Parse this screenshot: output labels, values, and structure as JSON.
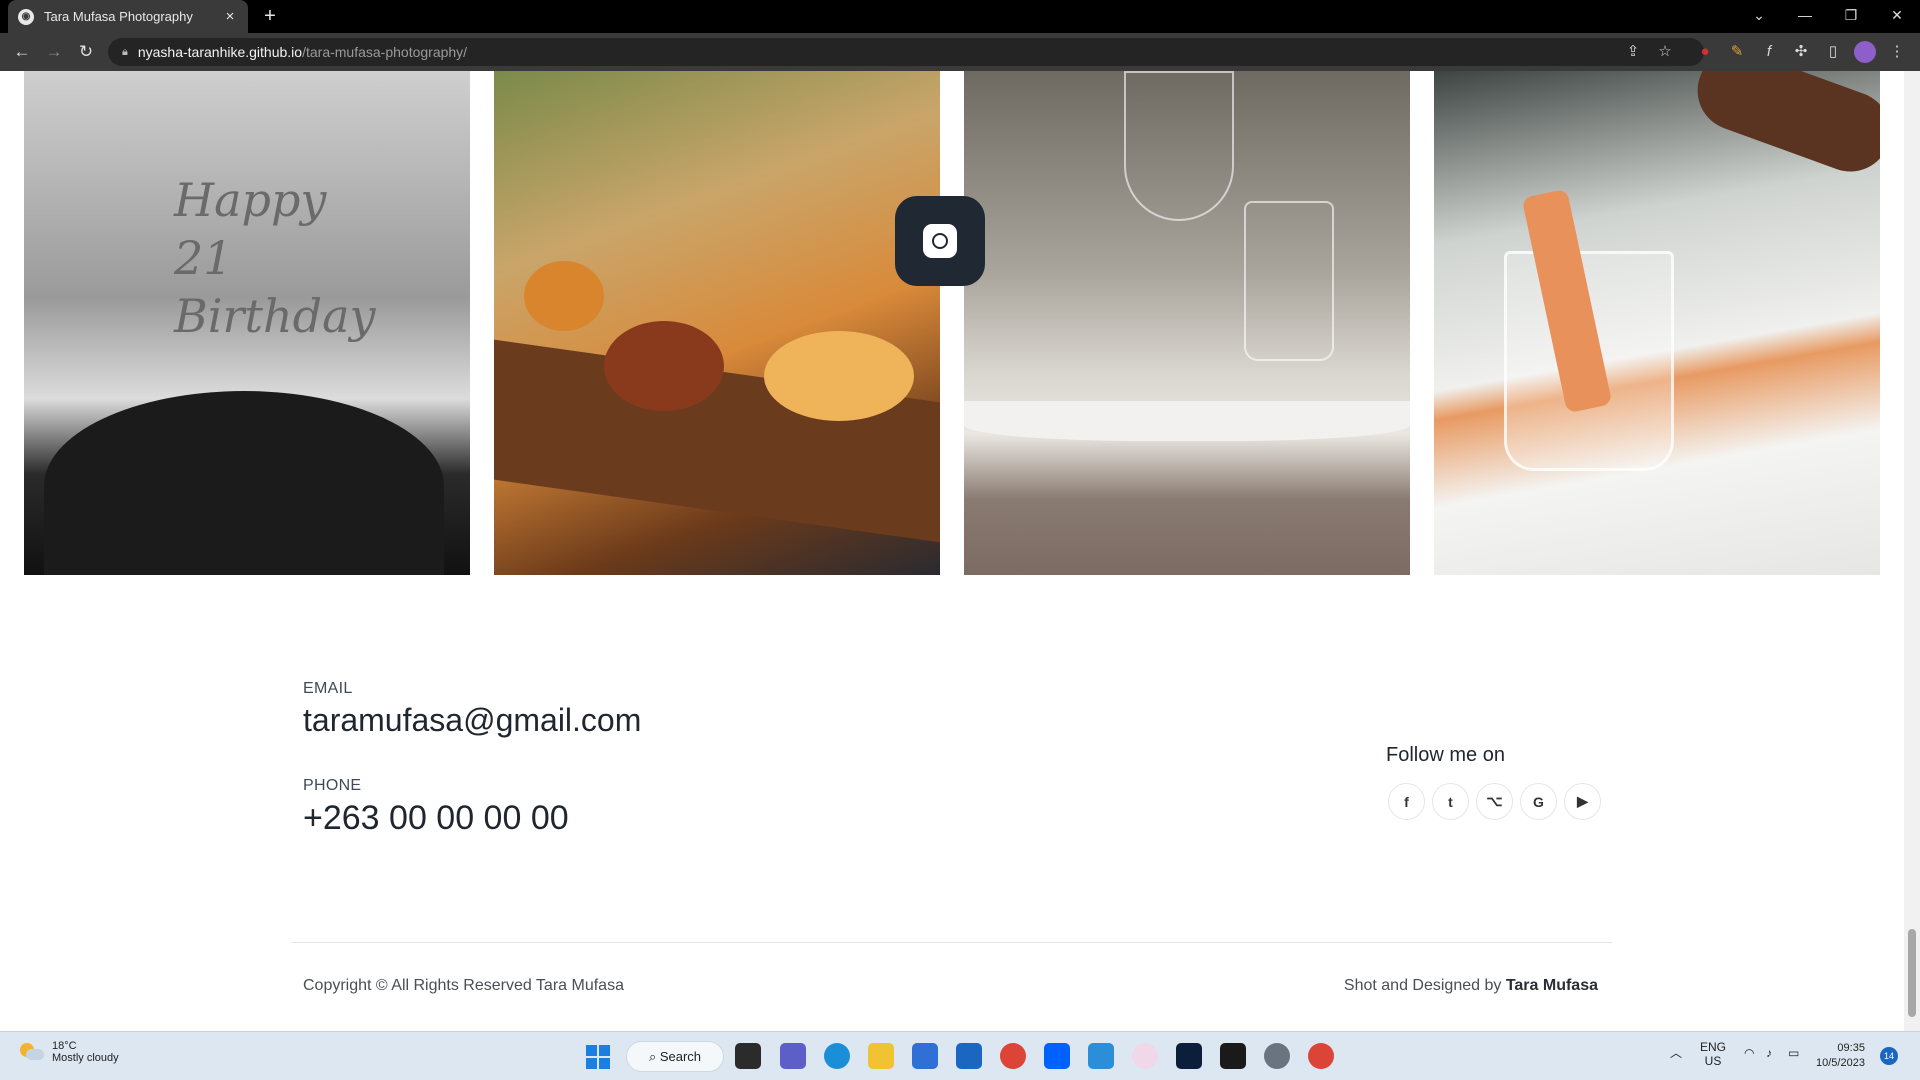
{
  "browser": {
    "tab_title": "Tara Mufasa Photography",
    "url_host": "nyasha-taranhike.github.io",
    "url_path": "/tara-mufasa-photography/",
    "new_tab_glyph": "+",
    "tab_close_glyph": "×"
  },
  "gallery": {
    "photos": [
      {
        "alt": "Happy 21st Birthday cake topper",
        "topper_text": "Happy 21 Birthday"
      },
      {
        "alt": "Food platter on wooden board"
      },
      {
        "alt": "Wine and water glasses on table"
      },
      {
        "alt": "Rosé bottles in ice bucket"
      }
    ],
    "instagram_icon": "instagram-icon"
  },
  "contact": {
    "email_label": "EMAIL",
    "email": "taramufasa@gmail.com",
    "phone_label": "PHONE",
    "phone": "+263 00 00 00 00"
  },
  "social": {
    "heading": "Follow me on",
    "icons": [
      "facebook-icon",
      "twitter-icon",
      "github-icon",
      "google-icon",
      "youtube-icon"
    ],
    "glyphs": [
      "f",
      "t",
      "⌥",
      "G",
      "▶"
    ]
  },
  "footer": {
    "copyright": "Copyright © All Rights Reserved Tara Mufasa",
    "credit_prefix": "Shot and Designed by",
    "credit_name": "Tara Mufasa"
  },
  "taskbar": {
    "weather_temp": "18°C",
    "weather_desc": "Mostly cloudy",
    "search_label": "Search",
    "lang_top": "ENG",
    "lang_bottom": "US",
    "time": "09:35",
    "date": "10/5/2023",
    "notifications": "14"
  },
  "colors": {
    "insta_button_bg": "#202833",
    "text_dark": "#1f2630"
  }
}
